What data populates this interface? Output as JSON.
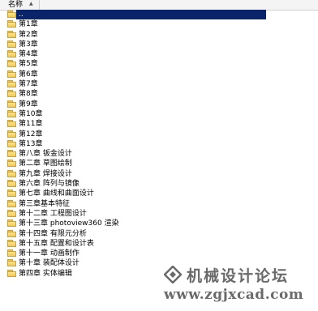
{
  "header": {
    "name_column": "名称"
  },
  "rows": [
    {
      "label": "..",
      "selected": true
    },
    {
      "label": "第1章"
    },
    {
      "label": "第2章"
    },
    {
      "label": "第3章"
    },
    {
      "label": "第4章"
    },
    {
      "label": "第5章"
    },
    {
      "label": "第6章"
    },
    {
      "label": "第7章"
    },
    {
      "label": "第8章"
    },
    {
      "label": "第9章"
    },
    {
      "label": "第10章"
    },
    {
      "label": "第11章"
    },
    {
      "label": "第12章"
    },
    {
      "label": "第13章"
    },
    {
      "label": "第八章 钣金设计"
    },
    {
      "label": "第二章 草图绘制"
    },
    {
      "label": "第九章 焊接设计"
    },
    {
      "label": "第六章 阵列与镜像"
    },
    {
      "label": "第七章 曲线和曲面设计"
    },
    {
      "label": "第三章基本特征"
    },
    {
      "label": "第十二章 工程图设计"
    },
    {
      "label": "第十三章 photoview360 渲染"
    },
    {
      "label": "第十四章 有限元分析"
    },
    {
      "label": "第十五章 配置和设计表"
    },
    {
      "label": "第十一章 动画制作"
    },
    {
      "label": "第十章 装配体设计"
    },
    {
      "label": "第四章 实体编辑"
    }
  ],
  "watermark": {
    "title": "机械设计论坛",
    "url": "www.zgjxcad.com",
    "color": "#6a6a6a"
  },
  "colors": {
    "selection": "#0a246a",
    "folder": "#f0c95a"
  }
}
